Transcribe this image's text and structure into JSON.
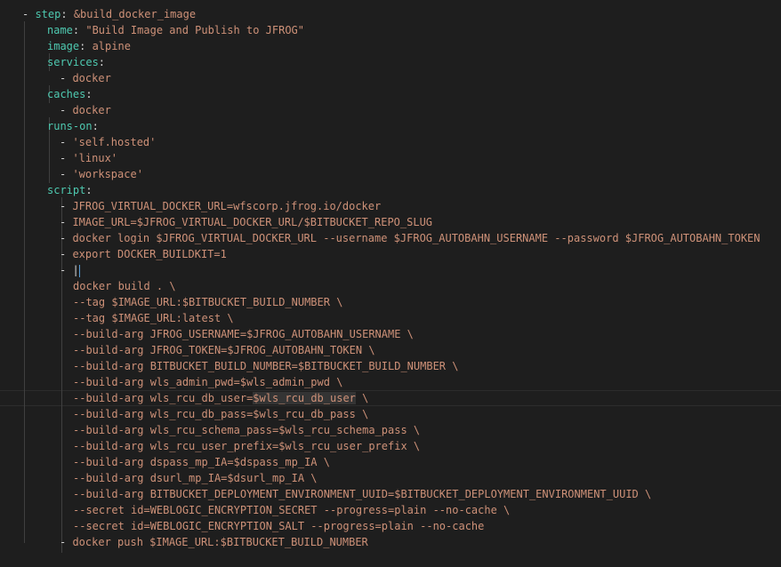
{
  "colors": {
    "background": "#1e1e1e",
    "key": "#4ec9b0",
    "string": "#ce9178",
    "dash": "#d4d4d4",
    "punct": "#d4d4d4",
    "indent_guide": "#404040"
  },
  "lines": [
    [
      [
        "dash",
        "- "
      ],
      [
        "key",
        "step"
      ],
      [
        "punct",
        ": "
      ],
      [
        "string",
        "&build_docker_image"
      ]
    ],
    [
      [
        "key",
        "name"
      ],
      [
        "punct",
        ": "
      ],
      [
        "string",
        "\"Build Image and Publish to JFROG\""
      ]
    ],
    [
      [
        "key",
        "image"
      ],
      [
        "punct",
        ": "
      ],
      [
        "string",
        "alpine"
      ]
    ],
    [
      [
        "key",
        "services"
      ],
      [
        "punct",
        ":"
      ]
    ],
    [
      [
        "dash",
        "- "
      ],
      [
        "string",
        "docker"
      ]
    ],
    [
      [
        "key",
        "caches"
      ],
      [
        "punct",
        ":"
      ]
    ],
    [
      [
        "dash",
        "- "
      ],
      [
        "string",
        "docker"
      ]
    ],
    [
      [
        "key",
        "runs-on"
      ],
      [
        "punct",
        ":"
      ]
    ],
    [
      [
        "dash",
        "- "
      ],
      [
        "string",
        "'self.hosted'"
      ]
    ],
    [
      [
        "dash",
        "- "
      ],
      [
        "string",
        "'linux'"
      ]
    ],
    [
      [
        "dash",
        "- "
      ],
      [
        "string",
        "'workspace'"
      ]
    ],
    [
      [
        "key",
        "script"
      ],
      [
        "punct",
        ":"
      ]
    ],
    [
      [
        "dash",
        "- "
      ],
      [
        "string",
        "JFROG_VIRTUAL_DOCKER_URL=wfscorp.jfrog.io/docker"
      ]
    ],
    [
      [
        "dash",
        "- "
      ],
      [
        "string",
        "IMAGE_URL=$JFROG_VIRTUAL_DOCKER_URL/$BITBUCKET_REPO_SLUG"
      ]
    ],
    [
      [
        "dash",
        "- "
      ],
      [
        "string",
        "docker login $JFROG_VIRTUAL_DOCKER_URL --username $JFROG_AUTOBAHN_USERNAME --password $JFROG_AUTOBAHN_TOKEN"
      ]
    ],
    [
      [
        "dash",
        "- "
      ],
      [
        "string",
        "export DOCKER_BUILDKIT=1"
      ]
    ],
    [
      [
        "dash",
        "- "
      ],
      [
        "punct",
        "|"
      ]
    ],
    [
      [
        "string",
        "docker build . \\"
      ]
    ],
    [
      [
        "string",
        "--tag $IMAGE_URL:$BITBUCKET_BUILD_NUMBER \\"
      ]
    ],
    [
      [
        "string",
        "--tag $IMAGE_URL:latest \\"
      ]
    ],
    [
      [
        "string",
        "--build-arg JFROG_USERNAME=$JFROG_AUTOBAHN_USERNAME \\"
      ]
    ],
    [
      [
        "string",
        "--build-arg JFROG_TOKEN=$JFROG_AUTOBAHN_TOKEN \\"
      ]
    ],
    [
      [
        "string",
        "--build-arg BITBUCKET_BUILD_NUMBER=$BITBUCKET_BUILD_NUMBER \\"
      ]
    ],
    [
      [
        "string",
        "--build-arg wls_admin_pwd=$wls_admin_pwd \\"
      ]
    ],
    [
      [
        "string",
        "--build-arg wls_rcu_db_user="
      ],
      [
        "stringhl",
        "$wls_rcu_db_user"
      ],
      [
        "string",
        " \\"
      ]
    ],
    [
      [
        "string",
        "--build-arg wls_rcu_db_pass=$wls_rcu_db_pass \\"
      ]
    ],
    [
      [
        "string",
        "--build-arg wls_rcu_schema_pass=$wls_rcu_schema_pass \\"
      ]
    ],
    [
      [
        "string",
        "--build-arg wls_rcu_user_prefix=$wls_rcu_user_prefix \\"
      ]
    ],
    [
      [
        "string",
        "--build-arg dspass_mp_IA=$dspass_mp_IA \\"
      ]
    ],
    [
      [
        "string",
        "--build-arg dsurl_mp_IA=$dsurl_mp_IA \\"
      ]
    ],
    [
      [
        "string",
        "--build-arg BITBUCKET_DEPLOYMENT_ENVIRONMENT_UUID=$BITBUCKET_DEPLOYMENT_ENVIRONMENT_UUID \\"
      ]
    ],
    [
      [
        "string",
        "--secret id=WEBLOGIC_ENCRYPTION_SECRET --progress=plain --no-cache \\"
      ]
    ],
    [
      [
        "string",
        "--secret id=WEBLOGIC_ENCRYPTION_SALT --progress=plain --no-cache"
      ]
    ],
    [
      [
        "dash",
        "- "
      ],
      [
        "string",
        "docker push $IMAGE_URL:$BITBUCKET_BUILD_NUMBER"
      ]
    ]
  ]
}
